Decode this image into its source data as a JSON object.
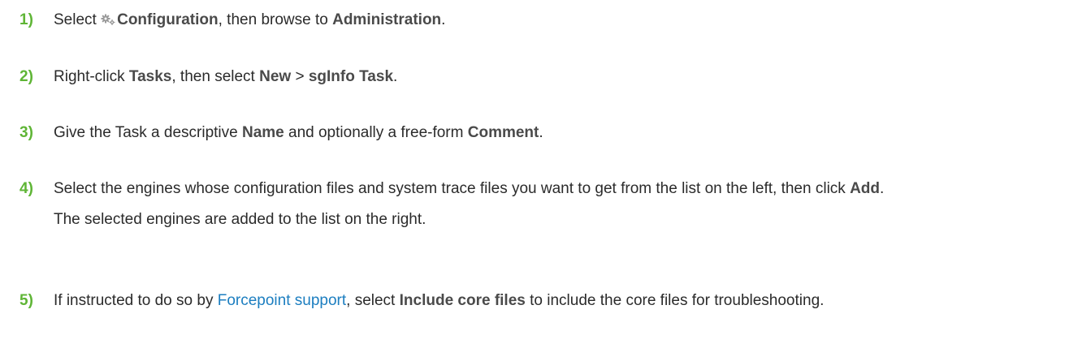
{
  "steps": [
    {
      "num": "1)",
      "p1": "Select ",
      "b1": "Configuration",
      "p2": ", then browse to ",
      "b2": "Administration",
      "p3": ".",
      "icon": "gear-icon"
    },
    {
      "num": "2)",
      "p1": "Right-click ",
      "b1": "Tasks",
      "p2": ", then select ",
      "b2": "New",
      "p3": " > ",
      "b3": "sgInfo Task",
      "p4": "."
    },
    {
      "num": "3)",
      "p1": "Give the Task a descriptive ",
      "b1": "Name",
      "p2": " and optionally a free-form ",
      "b2": "Comment",
      "p3": "."
    },
    {
      "num": "4)",
      "p1": "Select the engines whose configuration files and system trace files you want to get from the list on the left, then click ",
      "b1": "Add",
      "p2": ".",
      "sub": "The selected engines are added to the list on the right."
    },
    {
      "num": "5)",
      "p1": "If instructed to do so by ",
      "link": "Forcepoint support",
      "p2": ", select ",
      "b1": "Include core files",
      "p3": " to include the core files for troubleshooting."
    }
  ]
}
